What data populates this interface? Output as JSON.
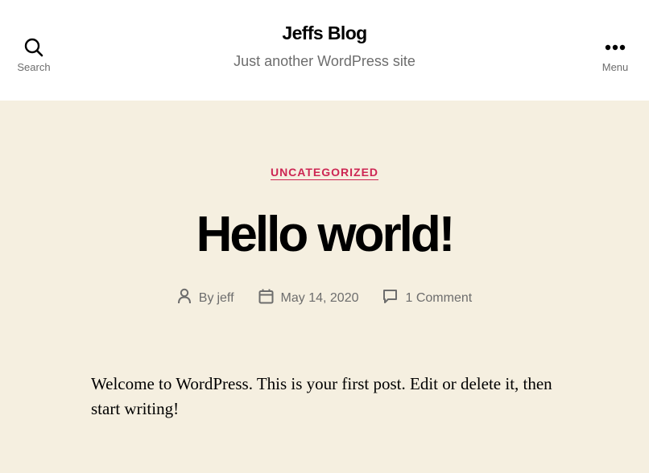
{
  "header": {
    "search_label": "Search",
    "menu_label": "Menu",
    "site_title": "Jeffs Blog",
    "site_description": "Just another WordPress site",
    "icons": {
      "search": "search-icon",
      "menu": "ellipsis-icon"
    }
  },
  "post": {
    "category": "UNCATEGORIZED",
    "title": "Hello world!",
    "meta": {
      "by_prefix": "By",
      "author": "jeff",
      "date": "May 14, 2020",
      "comments": "1 Comment",
      "icons": {
        "author": "user-icon",
        "date": "calendar-icon",
        "comments": "comment-icon"
      }
    },
    "content": "Welcome to WordPress. This is your first post. Edit or delete it, then start writing!"
  },
  "colors": {
    "accent": "#cd2653",
    "background": "#f5efe0",
    "header_background": "#ffffff",
    "secondary_text": "#6d6d6d"
  }
}
